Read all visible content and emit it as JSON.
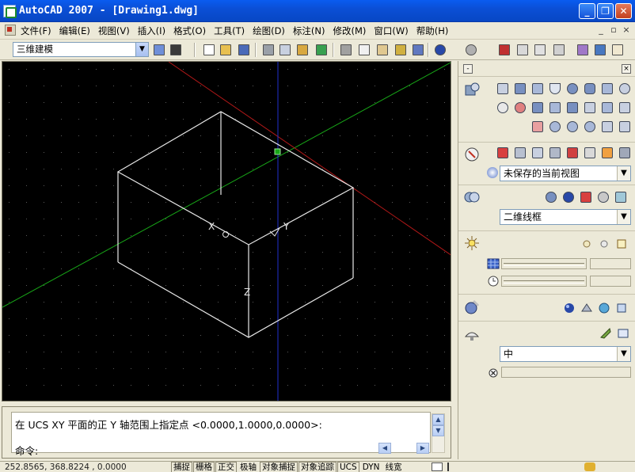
{
  "window": {
    "title": "AutoCAD 2007 - [Drawing1.dwg]",
    "minimize_icon": "minimize-icon",
    "restore_icon": "restore-icon",
    "close_icon": "close-icon"
  },
  "menubar": {
    "items": [
      {
        "label": "文件(F)"
      },
      {
        "label": "编辑(E)"
      },
      {
        "label": "视图(V)"
      },
      {
        "label": "插入(I)"
      },
      {
        "label": "格式(O)"
      },
      {
        "label": "工具(T)"
      },
      {
        "label": "绘图(D)"
      },
      {
        "label": "标注(N)"
      },
      {
        "label": "修改(M)"
      },
      {
        "label": "窗口(W)"
      },
      {
        "label": "帮助(H)"
      }
    ],
    "doc_controls": [
      "_",
      "▫",
      "×"
    ]
  },
  "toolbar": {
    "workspace": "三维建模",
    "icons": [
      "workspace-settings-icon",
      "my-workspace-icon",
      "new-icon",
      "open-icon",
      "save-icon",
      "plot-icon",
      "plot-preview-icon",
      "publish-icon",
      "3d-dwf-icon",
      "cut-icon",
      "copy-icon",
      "paste-icon",
      "match-properties-icon",
      "block-editor-icon",
      "undo-icon",
      "redo-icon",
      "pan-icon",
      "zoom-realtime-icon",
      "zoom-window-icon",
      "zoom-previous-icon",
      "properties-icon",
      "design-center-icon",
      "tool-palettes-icon"
    ]
  },
  "drawing": {
    "axis_labels": {
      "x": "X",
      "y": "Y",
      "z": "Z"
    },
    "colors": {
      "background": "#000000",
      "box": "#ffffff",
      "x_axis": "#cc1010",
      "y_axis": "#18a818",
      "z_axis": "#1828d8",
      "grid": "#5a5a5a"
    }
  },
  "command": {
    "line1": "在 UCS XY 平面的正 Y 轴范围上指定点 <0.0000,1.0000,0.0000>:",
    "line2": "命令:"
  },
  "status": {
    "coords": "252.8565, 368.8224 , 0.0000",
    "toggles": [
      "捕捉",
      "栅格",
      "正交",
      "极轴",
      "对象捕捉",
      "对象追踪",
      "UCS",
      "DYN",
      "线宽"
    ]
  },
  "dashboard": {
    "view_current": "未保存的当前视图",
    "visual_style": "二维线框",
    "material_option": "中"
  }
}
